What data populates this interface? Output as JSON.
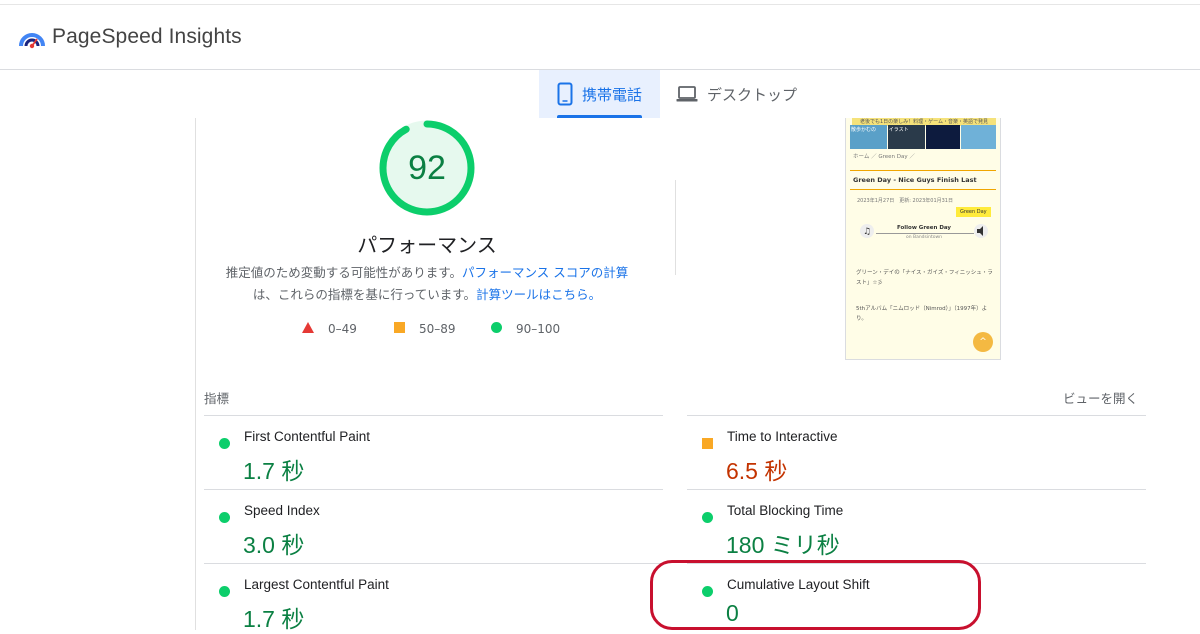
{
  "app": {
    "title": "PageSpeed Insights"
  },
  "tabs": [
    {
      "label": "携帯電話",
      "icon": "smartphone-icon",
      "active": true
    },
    {
      "label": "デスクトップ",
      "icon": "laptop-icon",
      "active": false
    }
  ],
  "performance": {
    "score": "92",
    "label": "パフォーマンス",
    "desc_prefix": "推定値のため変動する可能性があります。",
    "desc_link1": "パフォーマンス スコアの計算",
    "desc_middle": "は、これらの指標を基に行っています。",
    "desc_link2": "計算ツールはこちら。",
    "legend": [
      {
        "range": "0–49",
        "shape": "triangle",
        "color": "#e53935"
      },
      {
        "range": "50–89",
        "shape": "square",
        "color": "#f9a825"
      },
      {
        "range": "90–100",
        "shape": "circle",
        "color": "#0cce6b"
      }
    ]
  },
  "screenshot": {
    "banner": "老後でも1日の楽しみ！料理・ゲーム・音楽・英語で発見",
    "images": [
      "散歩かむの",
      "イラスト",
      "",
      ""
    ],
    "breadcrumb": "ホーム ／ Green Day ／",
    "post_title": "Green Day - Nice Guys Finish Last",
    "date": "2023年1月27日　更新: 2023年01月31日",
    "tag": "Green Day",
    "player_title": "Follow Green Day",
    "player_sub": "on Bandsintown",
    "text1": "グリーン・デイの「ナイス・ガイズ・フィニッシュ・ラスト」☆彡",
    "text2": "5thアルバム「ニムロッド（Nimrod）」（1997年）より。",
    "top_button": "^"
  },
  "metrics_section": {
    "label": "指標",
    "expand": "ビューを開く"
  },
  "metrics": [
    {
      "name": "First Contentful Paint",
      "value": "1.7 秒",
      "status": "good"
    },
    {
      "name": "Time to Interactive",
      "value": "6.5 秒",
      "status": "average"
    },
    {
      "name": "Speed Index",
      "value": "3.0 秒",
      "status": "good"
    },
    {
      "name": "Total Blocking Time",
      "value": "180 ミリ秒",
      "status": "good"
    },
    {
      "name": "Largest Contentful Paint",
      "value": "1.7 秒",
      "status": "good"
    },
    {
      "name": "Cumulative Layout Shift",
      "value": "0",
      "status": "good"
    }
  ],
  "colors": {
    "accent": "#1a73e8",
    "good": "#0cce6b",
    "good_text": "#0b8043",
    "average": "#f9a825",
    "average_text": "#c33300",
    "highlight": "#c8102e"
  }
}
